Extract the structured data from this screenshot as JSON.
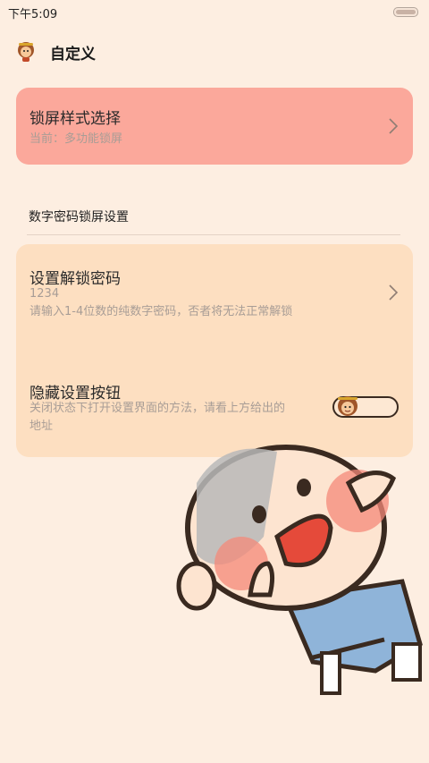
{
  "status_bar": {
    "time": "下午5:09"
  },
  "app_bar": {
    "title": "自定义"
  },
  "lock_style": {
    "title": "锁屏样式选择",
    "subtitle": "当前：多功能锁屏"
  },
  "section": {
    "title": "数字密码锁屏设置"
  },
  "set_password": {
    "title": "设置解锁密码",
    "value": "1234",
    "hint": "请输入1-4位数的纯数字密码，否者将无法正常解锁"
  },
  "hide_button": {
    "title": "隐藏设置按钮",
    "hint_line1": "关闭状态下打开设置界面的方法，请看上方给出的",
    "hint_line2": "地址",
    "toggle_on": false
  },
  "colors": {
    "background": "#fdeee1",
    "style_card": "#fba89b",
    "pin_card": "#fddfc1"
  }
}
